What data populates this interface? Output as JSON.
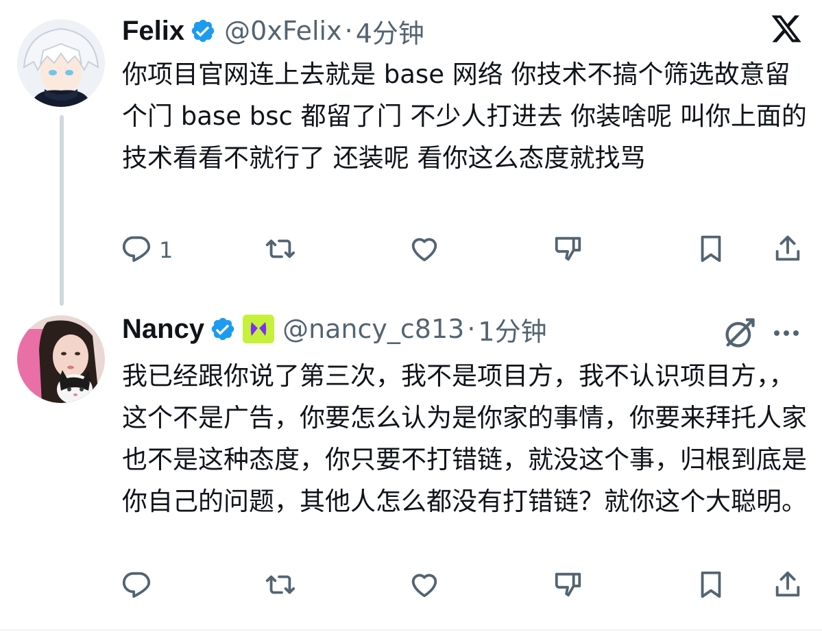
{
  "tweets": [
    {
      "display_name": "Felix",
      "handle": "@0xFelix",
      "separator": "·",
      "time": "4分钟",
      "text": "你项目官网连上去就是 base 网络 你技术不搞个筛选故意留个门 base bsc 都留了门 不少人打进去 你装啥呢 叫你上面的技术看看不就行了 还装呢 看你这么态度就找骂",
      "reply_count": "1",
      "retweet_count": "",
      "like_count": ""
    },
    {
      "display_name": "Nancy",
      "handle": "@nancy_c813",
      "separator": "·",
      "time": "1分钟",
      "text": "我已经跟你说了第三次，我不是项目方，我不认识项目方，，这个不是广告，你要怎么认为是你家的事情，你要来拜托人家也不是这种态度，你只要不打错链，就没这个事，归根到底是你自己的问题，其他人怎么都没有打错链？就你这个大聪明。",
      "reply_count": "",
      "retweet_count": "",
      "like_count": ""
    }
  ],
  "icons": {
    "verified": "verified-badge-icon",
    "affiliate": "affiliate-badge-icon",
    "x_logo": "x-logo-icon",
    "grok": "grok-icon",
    "more": "more-icon",
    "reply": "reply-icon",
    "retweet": "retweet-icon",
    "like": "like-icon",
    "dislike": "dislike-icon",
    "bookmark": "bookmark-icon",
    "share": "share-icon"
  },
  "colors": {
    "text_primary": "#0f1419",
    "text_secondary": "#536471",
    "verified_blue": "#1d9bf0",
    "affiliate_bg": "#c6f13a",
    "affiliate_fg": "#7b2ff7",
    "thread_line": "#cfd9de"
  }
}
